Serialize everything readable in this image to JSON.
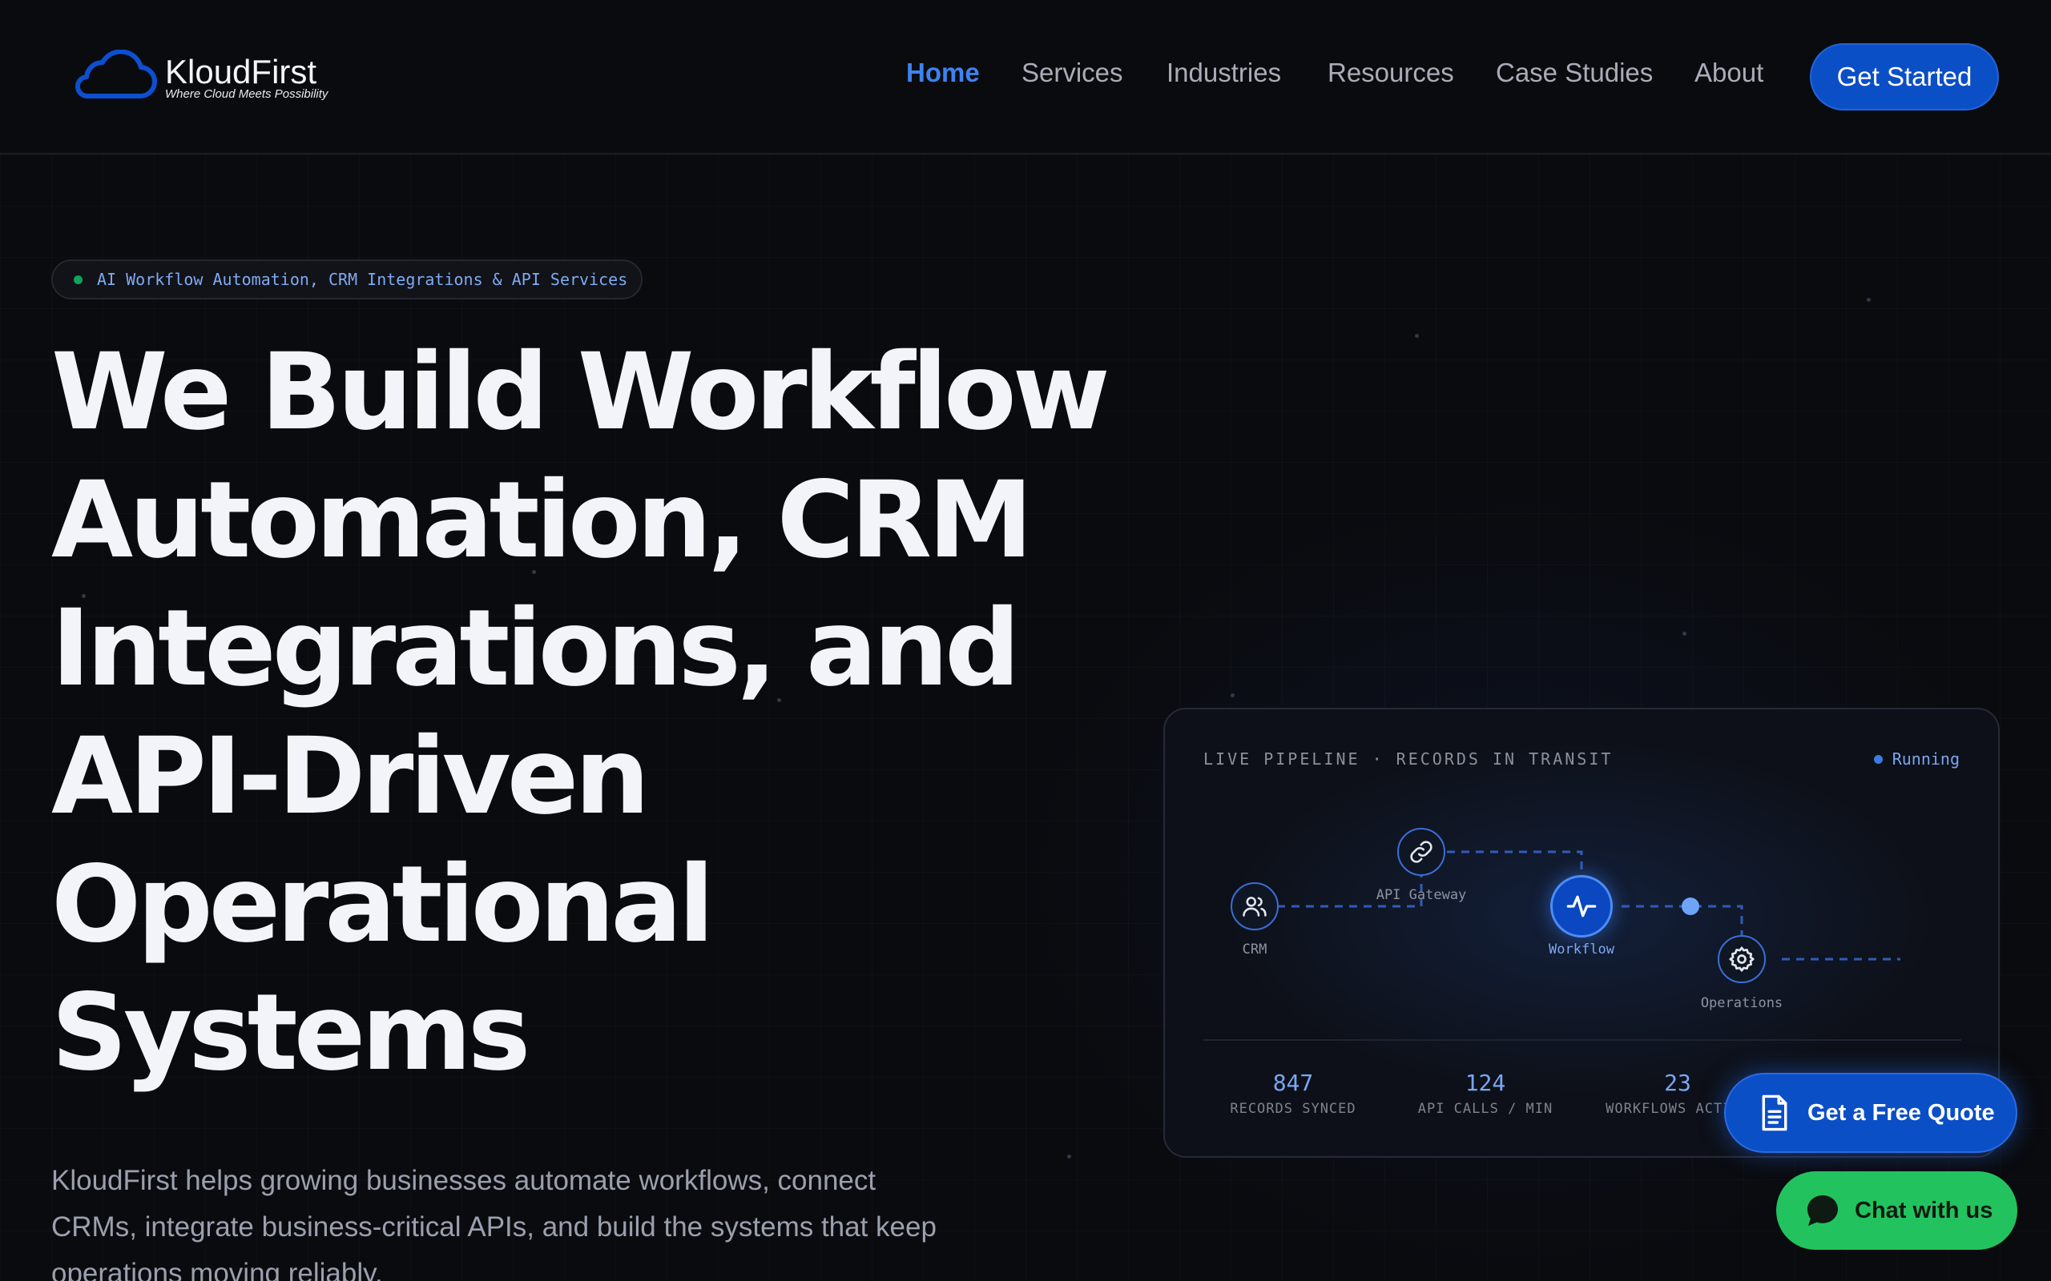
{
  "brand": {
    "name": "KloudFirst",
    "tagline": "Where Cloud Meets Possibility",
    "icon": "cloud-icon"
  },
  "nav": {
    "items": [
      {
        "label": "Home",
        "active": true
      },
      {
        "label": "Services",
        "active": false
      },
      {
        "label": "Industries",
        "active": false
      },
      {
        "label": "Resources",
        "active": false
      },
      {
        "label": "Case Studies",
        "active": false
      },
      {
        "label": "About",
        "active": false
      }
    ],
    "cta_label": "Get Started"
  },
  "hero": {
    "badge": "AI Workflow Automation, CRM Integrations & API Services",
    "headline_lines": [
      "We Build Workflow",
      "Automation, CRM",
      "Integrations, and",
      "API-Driven",
      "Operational",
      "Systems"
    ],
    "subtext": "KloudFirst helps growing businesses automate workflows, connect CRMs, integrate business-critical APIs, and build the systems that keep operations moving reliably."
  },
  "pipeline": {
    "title": "LIVE PIPELINE · RECORDS IN TRANSIT",
    "status": "Running",
    "nodes": [
      {
        "label": "CRM",
        "icon": "users-icon"
      },
      {
        "label": "API Gateway",
        "icon": "link-icon"
      },
      {
        "label": "Workflow",
        "icon": "activity-icon"
      },
      {
        "label": "Operations",
        "icon": "gear-icon"
      }
    ],
    "stats": [
      {
        "value": "847",
        "label": "RECORDS SYNCED"
      },
      {
        "value": "124",
        "label": "API CALLS / MIN"
      },
      {
        "value": "23",
        "label": "WORKFLOWS ACTIVE"
      }
    ]
  },
  "floating": {
    "quote_label": "Get a Free Quote",
    "quote_icon": "document-icon",
    "chat_label": "Chat with us",
    "chat_icon": "chat-bubble-icon"
  },
  "colors": {
    "background": "#0a0b0f",
    "accent_blue": "#0b4fc7",
    "nav_active": "#3d82f0",
    "chat_green": "#22c35e"
  }
}
